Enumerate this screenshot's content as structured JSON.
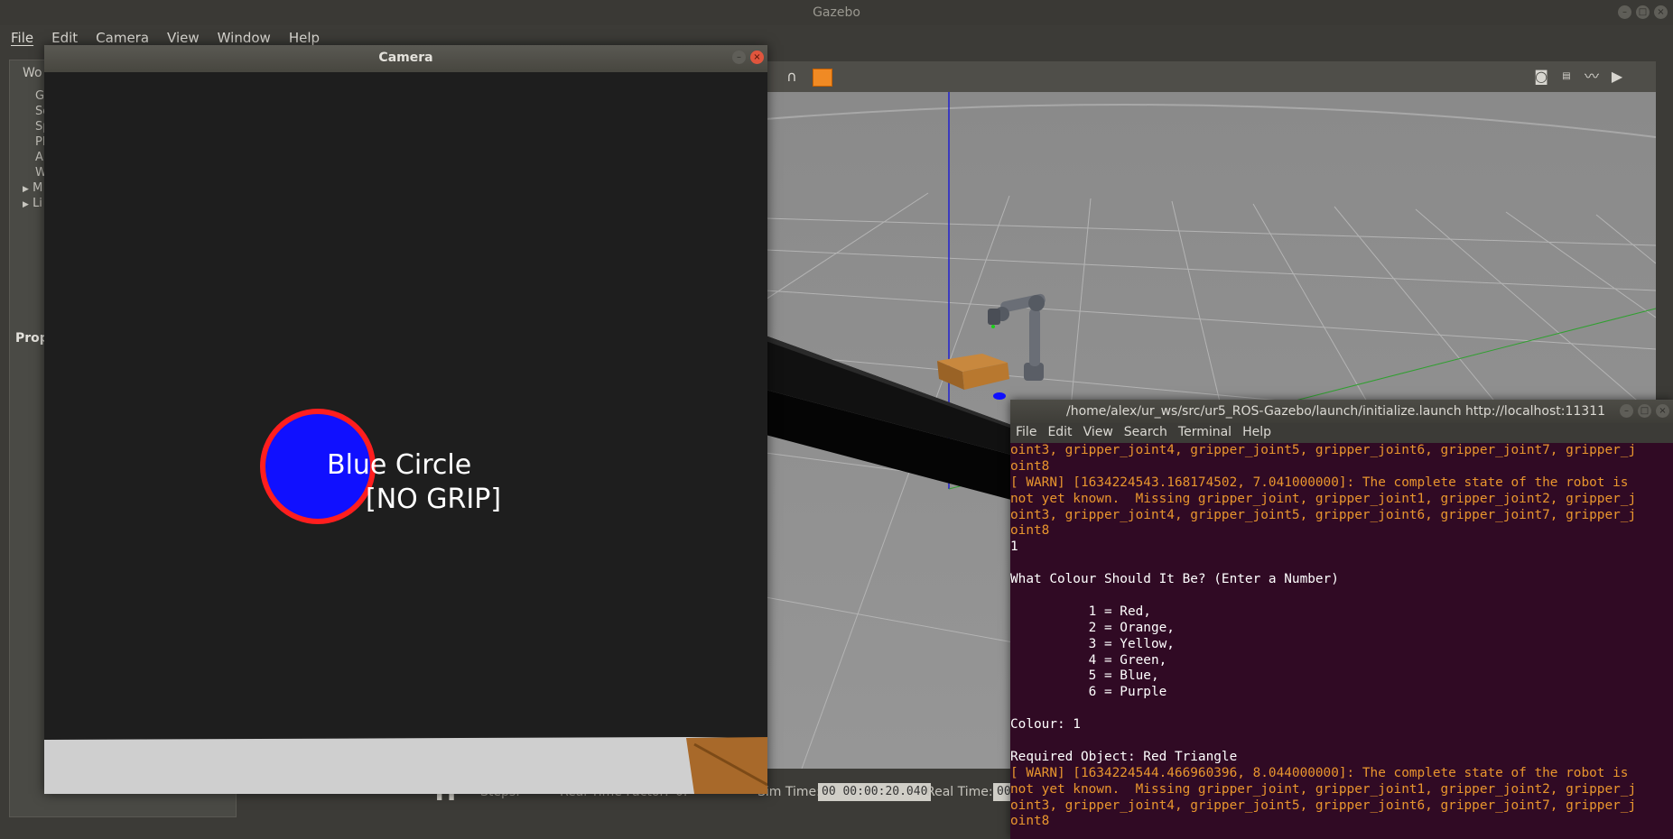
{
  "gazebo": {
    "title": "Gazebo",
    "menu": [
      "File",
      "Edit",
      "Camera",
      "View",
      "Window",
      "Help"
    ],
    "left_panel": {
      "tab_label": "Wo",
      "tree": [
        "G",
        "Sc",
        "Sp",
        "Pl",
        "A",
        "W",
        "M",
        "Li"
      ],
      "properties_label": "Prop"
    },
    "toolbar_icons": [
      "magnet-icon",
      "box-icon",
      "camera-icon",
      "log-icon",
      "plot-icon",
      "video-icon"
    ],
    "bottom_bar": {
      "steps_label": "Steps:",
      "real_time_factor_label": "Real Time Factor:",
      "real_time_factor_value": "0.",
      "sim_time_label": "Sim Time:",
      "sim_time_value": "00 00:00:20.040",
      "real_time_label": "Real Time:",
      "real_time_value": "00"
    }
  },
  "camera_window": {
    "title": "Camera",
    "shape_label": "Blue Circle",
    "grip_label": "[NO GRIP]",
    "circle_fill": "#1010ff",
    "circle_stroke": "#ff1e1e"
  },
  "terminal": {
    "title": "/home/alex/ur_ws/src/ur5_ROS-Gazebo/launch/initialize.launch http://localhost:11311",
    "menu": [
      "File",
      "Edit",
      "View",
      "Search",
      "Terminal",
      "Help"
    ],
    "lines": [
      {
        "t": "oint3, gripper_joint4, gripper_joint5, gripper_joint6, gripper_joint7, gripper_j",
        "k": "warn"
      },
      {
        "t": "oint8",
        "k": "warn"
      },
      {
        "t": "[ WARN] [1634224543.168174502, 7.041000000]: The complete state of the robot is",
        "k": "warn"
      },
      {
        "t": "not yet known.  Missing gripper_joint, gripper_joint1, gripper_joint2, gripper_j",
        "k": "warn"
      },
      {
        "t": "oint3, gripper_joint4, gripper_joint5, gripper_joint6, gripper_joint7, gripper_j",
        "k": "warn"
      },
      {
        "t": "oint8",
        "k": "warn"
      },
      {
        "t": "1",
        "k": "norm"
      },
      {
        "t": "",
        "k": "norm"
      },
      {
        "t": "What Colour Should It Be? (Enter a Number)",
        "k": "norm"
      },
      {
        "t": "",
        "k": "norm"
      },
      {
        "t": "          1 = Red,",
        "k": "norm"
      },
      {
        "t": "          2 = Orange,",
        "k": "norm"
      },
      {
        "t": "          3 = Yellow,",
        "k": "norm"
      },
      {
        "t": "          4 = Green,",
        "k": "norm"
      },
      {
        "t": "          5 = Blue,",
        "k": "norm"
      },
      {
        "t": "          6 = Purple",
        "k": "norm"
      },
      {
        "t": "",
        "k": "norm"
      },
      {
        "t": "Colour: 1",
        "k": "norm"
      },
      {
        "t": "",
        "k": "norm"
      },
      {
        "t": "Required Object: Red Triangle",
        "k": "norm"
      },
      {
        "t": "[ WARN] [1634224544.466960396, 8.044000000]: The complete state of the robot is",
        "k": "warn"
      },
      {
        "t": "not yet known.  Missing gripper_joint, gripper_joint1, gripper_joint2, gripper_j",
        "k": "warn"
      },
      {
        "t": "oint3, gripper_joint4, gripper_joint5, gripper_joint6, gripper_joint7, gripper_j",
        "k": "warn"
      },
      {
        "t": "oint8",
        "k": "warn"
      }
    ]
  }
}
